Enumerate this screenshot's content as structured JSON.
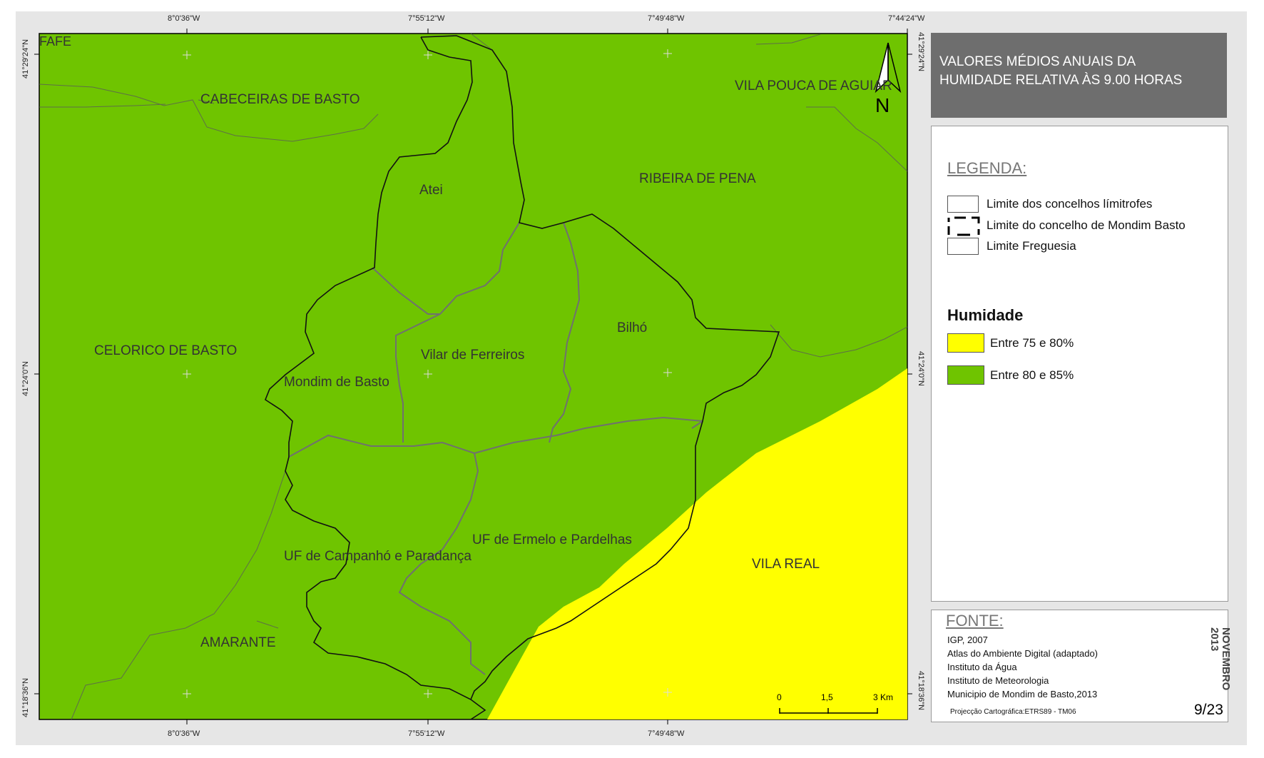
{
  "map": {
    "coords_top": [
      "8°0'36\"W",
      "7°55'12\"W",
      "7°49'48\"W",
      "7°44'24\"W"
    ],
    "coords_bottom": [
      "8°0'36\"W",
      "7°55'12\"W",
      "7°49'48\"W"
    ],
    "coords_left": [
      "41°29'24\"N",
      "41°24'0\"N",
      "41°18'36\"N"
    ],
    "coords_right": [
      "41°29'24\"N",
      "41°24'0\"N",
      "41°18'36\"N"
    ],
    "labels": {
      "fafe": "FAFE",
      "cabeceiras": "CABECEIRAS DE BASTO",
      "vila_pouca": "VILA POUCA DE AGUIAR",
      "ribeira": "RIBEIRA DE PENA",
      "atei": "Atei",
      "celorico": "CELORICO DE BASTO",
      "mondim": "Mondim de Basto",
      "vilar": "Vilar de Ferreiros",
      "bilho": "Bilhó",
      "ermelo": "UF de Ermelo e Pardelhas",
      "campanho": "UF de Campanhó e Paradança",
      "vila_real": "VILA REAL",
      "amarante": "AMARANTE"
    },
    "north": "N",
    "scale": {
      "s0": "0",
      "s1": "1,5",
      "s2": "3 Km"
    },
    "colors": {
      "humidity_80_85": "#6fc400",
      "humidity_75_80": "#ffff00"
    }
  },
  "title": {
    "line1": "VALORES MÉDIOS ANUAIS DA",
    "line2": "HUMIDADE RELATIVA ÀS 9.00 HORAS"
  },
  "legend": {
    "heading": "LEGENDA:",
    "items": [
      "Limite dos concelhos límitrofes",
      "Limite do concelho de Mondim Basto",
      "Limite Freguesia"
    ],
    "humidity_title": "Humidade",
    "classes": [
      "Entre 75 e 80%",
      "Entre 80 e 85%"
    ]
  },
  "fonte": {
    "heading": "FONTE:",
    "lines": [
      "IGP, 2007",
      "Atlas do Ambiente Digital (adaptado)",
      "Instituto da Água",
      "Instituto de Meteorologia",
      "Municipio de Mondim de Basto,2013"
    ],
    "projection": "Projecção Cartográfica:ETRS89 - TM06",
    "date": "NOVEMBRO 2013",
    "page": "9/23"
  }
}
